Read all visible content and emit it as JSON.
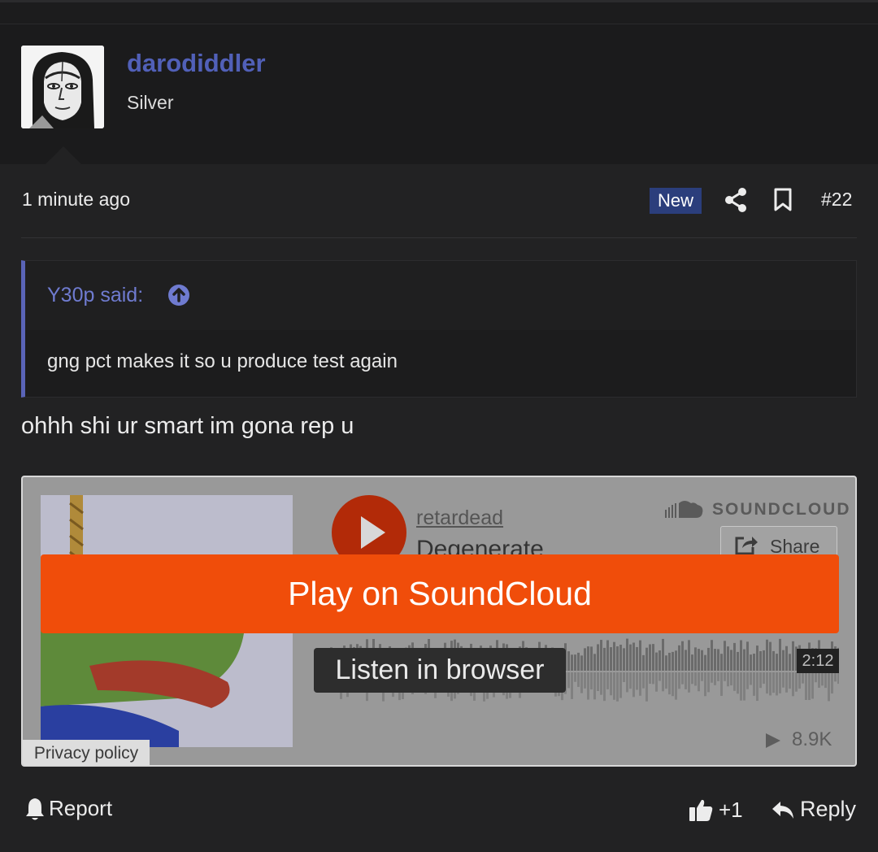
{
  "post": {
    "author": "darodiddler",
    "rank": "Silver",
    "time": "1 minute ago",
    "badge": "New",
    "number": "#22"
  },
  "quote": {
    "author_label": "Y30p said:",
    "text": "gng pct makes it so u produce test again"
  },
  "message": "ohhh shi ur smart im gona rep u",
  "embed": {
    "artist": "retardead",
    "track": "Degenerate",
    "brand": "SOUNDCLOUD",
    "share_label": "Share",
    "play_label": "Play on SoundCloud",
    "listen_label": "Listen in browser",
    "duration": "2:12",
    "plays": "8.9K",
    "privacy_label": "Privacy policy",
    "accent_color": "#f04d0a"
  },
  "footer": {
    "report_label": "Report",
    "like_label": "+1",
    "reply_label": "Reply"
  },
  "colors": {
    "username": "#5160b8",
    "badge_bg": "#2b3e7c",
    "quote_accent": "#5a64b8"
  }
}
